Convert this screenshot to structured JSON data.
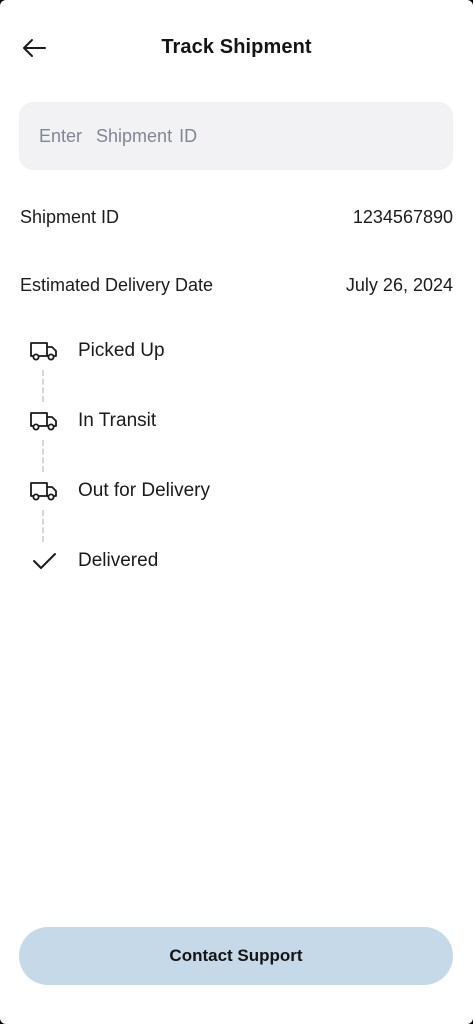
{
  "header": {
    "title": "Track Shipment",
    "back_icon": "arrow-left-icon"
  },
  "search": {
    "placeholder": "Enter  Shipment ID",
    "value": ""
  },
  "details": {
    "shipment_id_label": "Shipment ID",
    "shipment_id_value": "1234567890",
    "delivery_date_label": "Estimated Delivery Date",
    "delivery_date_value": "July 26, 2024"
  },
  "timeline": {
    "steps": [
      {
        "label": "Picked Up",
        "icon": "truck-icon"
      },
      {
        "label": "In Transit",
        "icon": "truck-icon"
      },
      {
        "label": "Out for Delivery",
        "icon": "truck-icon"
      },
      {
        "label": "Delivered",
        "icon": "checkmark-icon"
      }
    ]
  },
  "footer": {
    "contact_label": "Contact Support"
  },
  "colors": {
    "background": "#ffffff",
    "input_bg": "#f2f2f4",
    "placeholder": "#7f8794",
    "button_bg": "#c6d9e9",
    "text": "#141414",
    "connector": "#d6d6d8"
  }
}
